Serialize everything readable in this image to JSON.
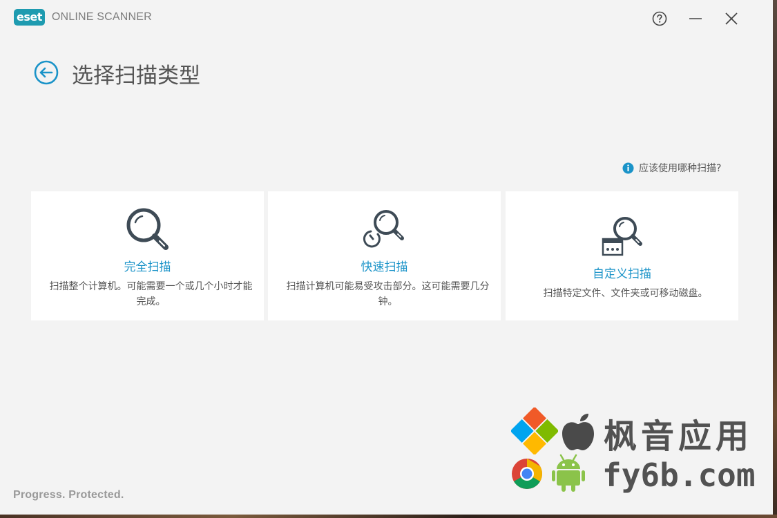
{
  "app": {
    "brand": "eset",
    "name": "ONLINE SCANNER"
  },
  "titlebar": {
    "help_icon": "question-circle-icon",
    "minimize_icon": "minimize-icon",
    "close_icon": "close-icon"
  },
  "page": {
    "title": "选择扫描类型",
    "help_link": "应该使用哪种扫描?"
  },
  "cards": [
    {
      "title": "完全扫描",
      "description": "扫描整个计算机。可能需要一个或几个小时才能完成。",
      "icon": "magnifier-icon"
    },
    {
      "title": "快速扫描",
      "description": "扫描计算机可能易受攻击部分。这可能需要几分钟。",
      "icon": "quick-scan-icon"
    },
    {
      "title": "自定义扫描",
      "description": "扫描特定文件、文件夹或可移动磁盘。",
      "icon": "custom-scan-icon"
    }
  ],
  "footer": {
    "tagline": "Progress. Protected."
  },
  "watermark": {
    "line1": "枫音应用",
    "line2": "fy6b.com"
  },
  "colors": {
    "accent": "#1a93c8",
    "logo": "#1e9bb0",
    "background": "#f3f3f3",
    "card": "#ffffff"
  }
}
